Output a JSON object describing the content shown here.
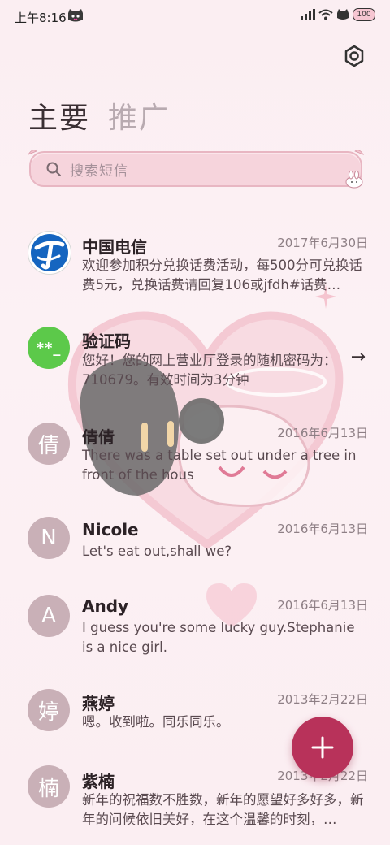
{
  "status": {
    "time": "上午8:16",
    "battery": "100"
  },
  "tabs": [
    {
      "label": "主要"
    },
    {
      "label": "推广"
    }
  ],
  "search": {
    "placeholder": "搜索短信"
  },
  "colors": {
    "accent": "#b8325a",
    "green_badge": "#5cc94a",
    "letter_avatar": "#c9b0b7",
    "search_bg": "#f6d4dc"
  },
  "messages": [
    {
      "sender": "中国电信",
      "avatar": "telecom-logo",
      "date": "2017年6月30日",
      "snippet": "欢迎参加积分兑换话费活动，每500分可兑换话费5元，兑换话费请回复106或jfdh#话费…"
    },
    {
      "sender": "验证码",
      "avatar_text": "**_",
      "date": "",
      "snippet": "您好！您的网上营业厅登录的随机密码为：710679。有效时间为3分钟",
      "arrow": "→"
    },
    {
      "sender": "倩倩",
      "avatar_text": "倩",
      "date": "2016年6月13日",
      "snippet": "There was a table set out under a tree in front of the hous"
    },
    {
      "sender": "Nicole",
      "avatar_text": "N",
      "date": "2016年6月13日",
      "snippet": "Let's eat out,shall we?"
    },
    {
      "sender": "Andy",
      "avatar_text": "A",
      "date": "2016年6月13日",
      "snippet": "I guess you're some lucky guy.Stephanie is a nice girl."
    },
    {
      "sender": "燕婷",
      "avatar_text": "婷",
      "date": "2013年2月22日",
      "snippet": "嗯。收到啦。同乐同乐。"
    },
    {
      "sender": "紫楠",
      "avatar_text": "楠",
      "date": "2013年2月22日",
      "snippet": "新年的祝福数不胜数，新年的愿望好多好多，新年的问候依旧美好，在这个温馨的时刻，…"
    }
  ],
  "fab": {
    "icon": "plus-icon"
  }
}
